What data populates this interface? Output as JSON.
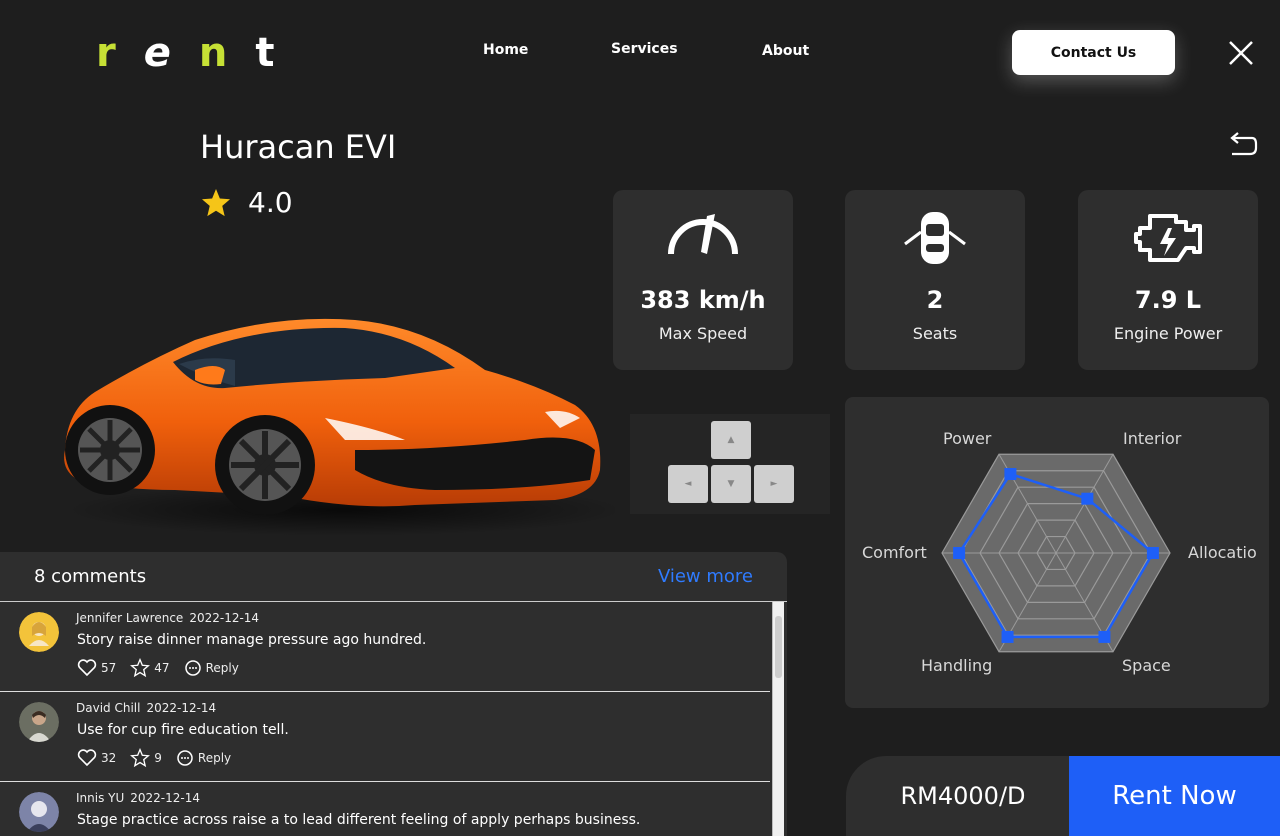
{
  "logo": {
    "letters": [
      "r",
      "e",
      "n",
      "t"
    ]
  },
  "nav": {
    "home": "Home",
    "services": "Services",
    "about": "About",
    "contact": "Contact Us"
  },
  "car": {
    "name": "Huracan EVI",
    "rating": "4.0"
  },
  "specs": [
    {
      "value": "383 km/h",
      "label": "Max Speed",
      "icon": "speedometer-icon"
    },
    {
      "value": "2",
      "label": "Seats",
      "icon": "car-seats-icon"
    },
    {
      "value": "7.9 L",
      "label": "Engine Power",
      "icon": "engine-icon"
    }
  ],
  "radar": {
    "labels": [
      "Power",
      "Interior",
      "Allocatio",
      "Space",
      "Handling",
      "Comfort"
    ],
    "values": [
      0.8,
      0.55,
      0.85,
      0.85,
      0.85,
      0.85
    ],
    "color": "#1e5ff7"
  },
  "comments": {
    "count_label": "8 comments",
    "view_more": "View more",
    "items": [
      {
        "name": "Jennifer Lawrence",
        "date": "2022-12-14",
        "text": "Story raise dinner manage pressure ago hundred.",
        "likes": "57",
        "stars": "47",
        "reply": "Reply"
      },
      {
        "name": "David Chill",
        "date": "2022-12-14",
        "text": "Use for cup fire education tell.",
        "likes": "32",
        "stars": "9",
        "reply": "Reply"
      },
      {
        "name": "Innis YU",
        "date": "2022-12-14",
        "text": "Stage practice across raise a to lead different feeling of apply perhaps business.",
        "likes": "",
        "stars": "",
        "reply": ""
      }
    ]
  },
  "price": "RM4000/D",
  "rent_button": "Rent Now",
  "colors": {
    "accent": "#1e5ff7",
    "logo_green": "#c6e035",
    "link_blue": "#2f7bff",
    "star": "#f5c518"
  }
}
